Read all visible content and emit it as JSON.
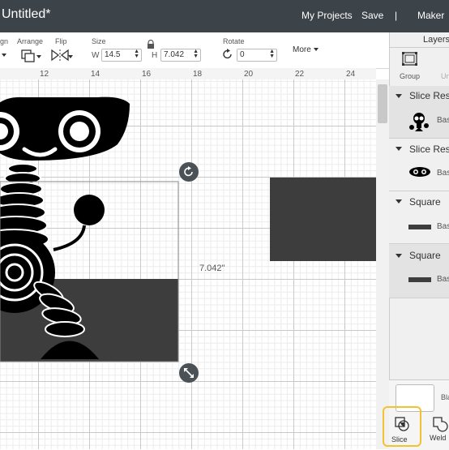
{
  "header": {
    "title": "Untitled*",
    "my_projects": "My Projects",
    "save": "Save",
    "separator": "|",
    "maker": "Maker"
  },
  "toolbar": {
    "align_label": "gn",
    "arrange_label": "Arrange",
    "flip_label": "Flip",
    "size_label": "Size",
    "w_label": "W",
    "w_value": "14.5",
    "h_label": "H",
    "h_value": "7.042",
    "rotate_label": "Rotate",
    "rotate_value": "0",
    "more_label": "More"
  },
  "ruler": {
    "ticks": [
      "12",
      "14",
      "16",
      "18",
      "20",
      "22",
      "24"
    ]
  },
  "canvas": {
    "dimension_label": "7.042\""
  },
  "layers": {
    "title": "Layers",
    "group_label": "Group",
    "ungroup_label": "Un",
    "items": [
      {
        "name": "Slice Res",
        "sub": "Bas",
        "icon": "robot-thumbnail"
      },
      {
        "name": "Slice Res",
        "sub": "Bas",
        "icon": "eyes-thumbnail"
      },
      {
        "name": "Square",
        "sub": "Bas",
        "icon": "rectangle-thumbnail"
      },
      {
        "name": "Square",
        "sub": "Bas",
        "icon": "rectangle-thumbnail"
      }
    ],
    "blank_label": "Bla",
    "slice_label": "Slice",
    "weld_label": "Weld"
  },
  "colors": {
    "header_bg": "#3c4349",
    "shape_fill": "#3d3d3d",
    "highlight": "#f2c230",
    "handle": "#4a5157"
  }
}
